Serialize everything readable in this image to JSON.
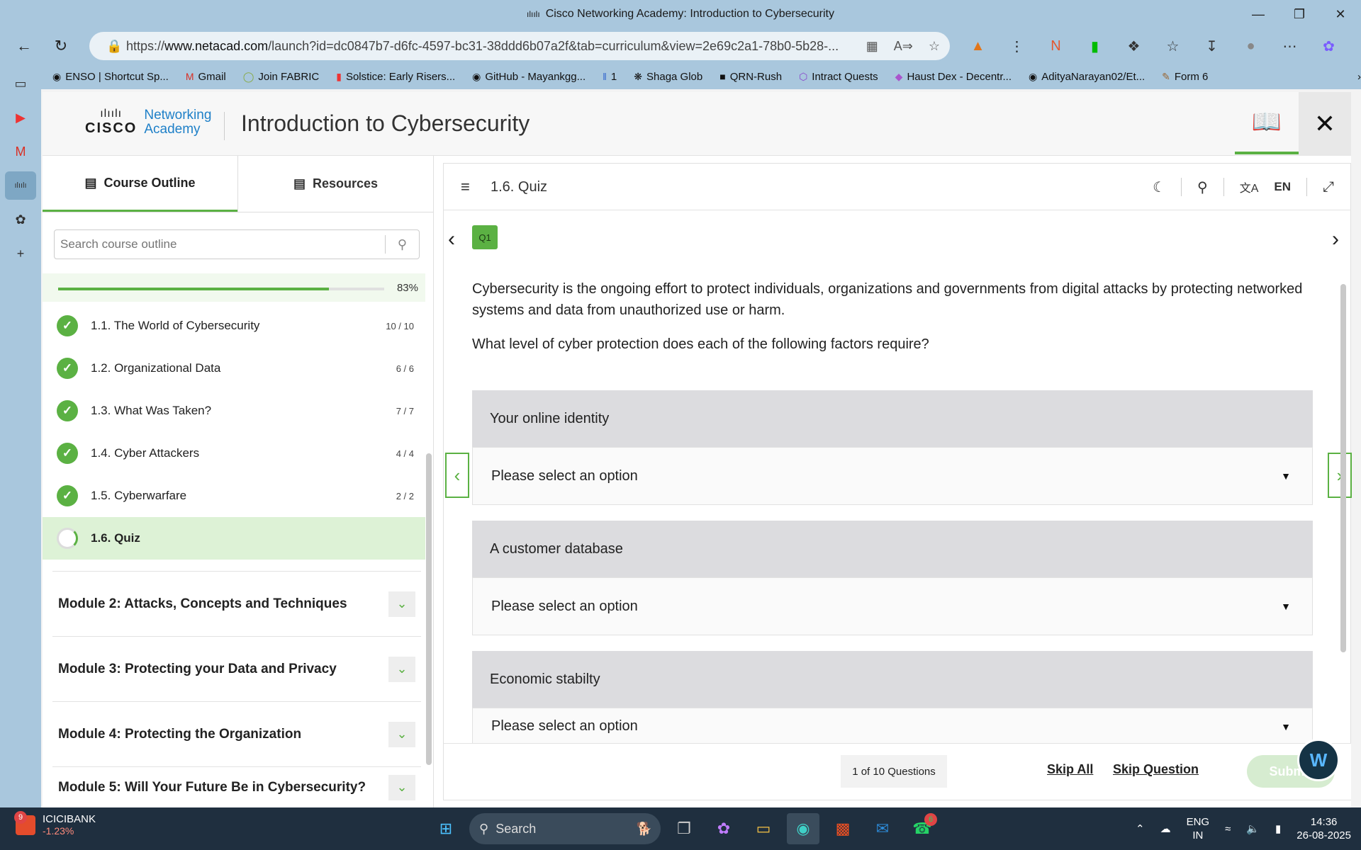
{
  "browser": {
    "window_title": "Cisco Networking Academy: Introduction to Cybersecurity",
    "url_prefix": "https://",
    "url_host": "www.netacad.com",
    "url_rest": "/launch?id=dc0847b7-d6fc-4597-bc31-38ddd6b07a2f&tab=curriculum&view=2e69c2a1-78b0-5b28-...",
    "bookmarks": [
      {
        "icon": "ENSO",
        "label": "ENSO | Shortcut Sp..."
      },
      {
        "icon": "M",
        "label": "Gmail"
      },
      {
        "icon": "()",
        "label": "Join FABRIC"
      },
      {
        "icon": "S",
        "label": "Solstice: Early Risers..."
      },
      {
        "icon": "GH",
        "label": "GitHub - Mayankgg..."
      },
      {
        "icon": "1",
        "label": "1"
      },
      {
        "icon": "SG",
        "label": "Shaga Glob"
      },
      {
        "icon": "QR",
        "label": "QRN-Rush"
      },
      {
        "icon": "IQ",
        "label": "Intract Quests"
      },
      {
        "icon": "H",
        "label": "Haust Dex - Decentr..."
      },
      {
        "icon": "GH",
        "label": "AdityaNarayan02/Et..."
      },
      {
        "icon": "F",
        "label": "Form 6"
      }
    ]
  },
  "app": {
    "logo_cisco": "CISCO",
    "logo_networking": "Networking",
    "logo_academy": "Academy",
    "course_title": "Introduction to Cybersecurity"
  },
  "sidebar": {
    "tab_outline": "Course Outline",
    "tab_resources": "Resources",
    "search_placeholder": "Search course outline",
    "progress_pct": "83%",
    "progress_value": 0.83,
    "lessons": [
      {
        "label": "1.1. The World of Cybersecurity",
        "count": "10 / 10"
      },
      {
        "label": "1.2. Organizational Data",
        "count": "6 / 6"
      },
      {
        "label": "1.3. What Was Taken?",
        "count": "7 / 7"
      },
      {
        "label": "1.4. Cyber Attackers",
        "count": "4 / 4"
      },
      {
        "label": "1.5. Cyberwarfare",
        "count": "2 / 2"
      },
      {
        "label": "1.6. Quiz",
        "count": ""
      }
    ],
    "modules": [
      "Module 2: Attacks, Concepts and Techniques",
      "Module 3: Protecting your Data and Privacy",
      "Module 4: Protecting the Organization",
      "Module 5: Will Your Future Be in Cybersecurity?"
    ]
  },
  "content": {
    "section": "1.6. Quiz",
    "lang": "EN",
    "question_badge": "Q1",
    "question_text": "Cybersecurity is the ongoing effort to protect individuals, organizations and governments from digital attacks by protecting networked systems and data from unauthorized use or harm.",
    "prompt": "What level of cyber protection does each of the following factors require?",
    "items": [
      {
        "label": "Your online identity",
        "select": "Please select an option"
      },
      {
        "label": "A customer database",
        "select": "Please select an option"
      },
      {
        "label": "Economic stabilty",
        "select": "Please select an option"
      }
    ],
    "question_count": "1 of 10 Questions",
    "skip_all": "Skip All",
    "skip_question": "Skip Question",
    "submit": "Submit"
  },
  "taskbar": {
    "stock_name": "ICICIBANK",
    "stock_change": "-1.23%",
    "stock_badge": "9",
    "search": "Search",
    "whatsapp_badge": "6",
    "lang_top": "ENG",
    "lang_bottom": "IN",
    "time": "14:36",
    "date": "26-08-2025"
  }
}
